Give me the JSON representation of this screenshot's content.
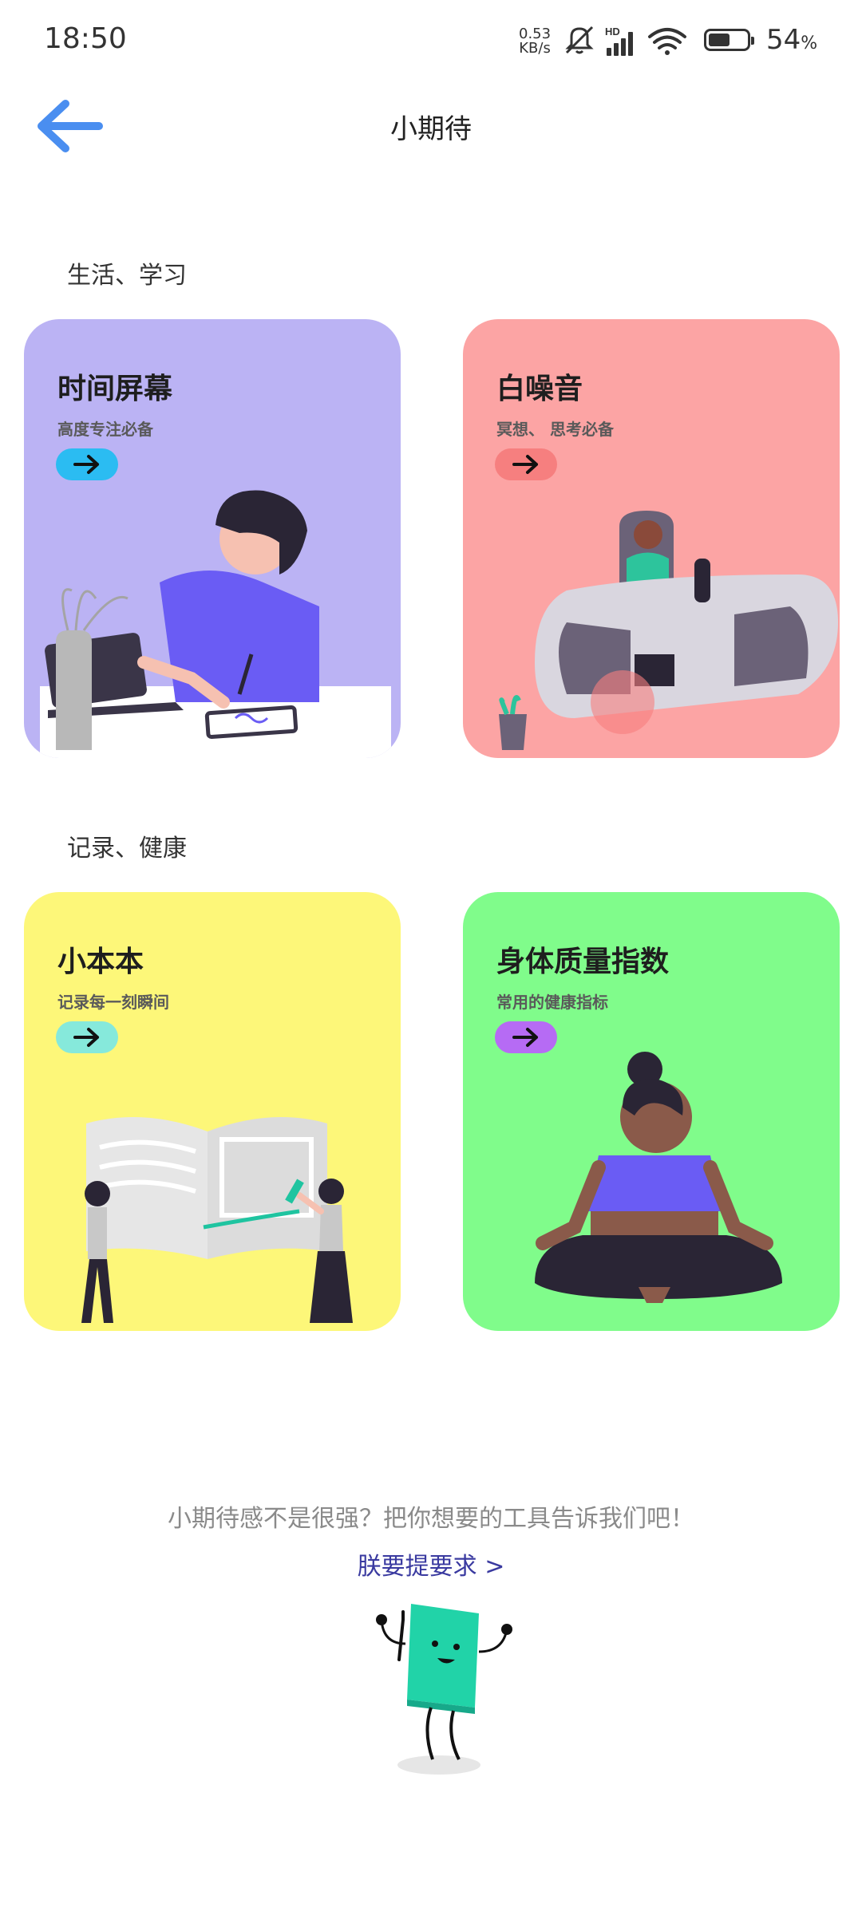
{
  "status_bar": {
    "time": "18:50",
    "net_speed_value": "0.53",
    "net_speed_unit": "KB/s",
    "network_label": "HD",
    "battery_percent": "54",
    "battery_unit": "%"
  },
  "header": {
    "title": "小期待"
  },
  "sections": [
    {
      "title": "生活、学习",
      "cards": [
        {
          "title": "时间屏幕",
          "subtitle": "高度专注必备",
          "bg": "#bbb3f4",
          "button_color": "#2bbcf2"
        },
        {
          "title": "白噪音",
          "subtitle": "冥想、 思考必备",
          "bg": "#fca4a4",
          "button_color": "#f67f7f"
        }
      ]
    },
    {
      "title": "记录、健康",
      "cards": [
        {
          "title": "小本本",
          "subtitle": "记录每一刻瞬间",
          "bg": "#fdf779",
          "button_color": "#86e9db"
        },
        {
          "title": "身体质量指数",
          "subtitle": "常用的健康指标",
          "bg": "#80fc8b",
          "button_color": "#b66bf4"
        }
      ]
    }
  ],
  "footer": {
    "prompt": "小期待感不是很强？把你想要的工具告诉我们吧！",
    "link": "朕要提要求  >"
  },
  "icons": [
    "back-arrow-icon",
    "mute-icon",
    "signal-icon",
    "wifi-icon",
    "battery-icon",
    "arrow-right-icon"
  ]
}
